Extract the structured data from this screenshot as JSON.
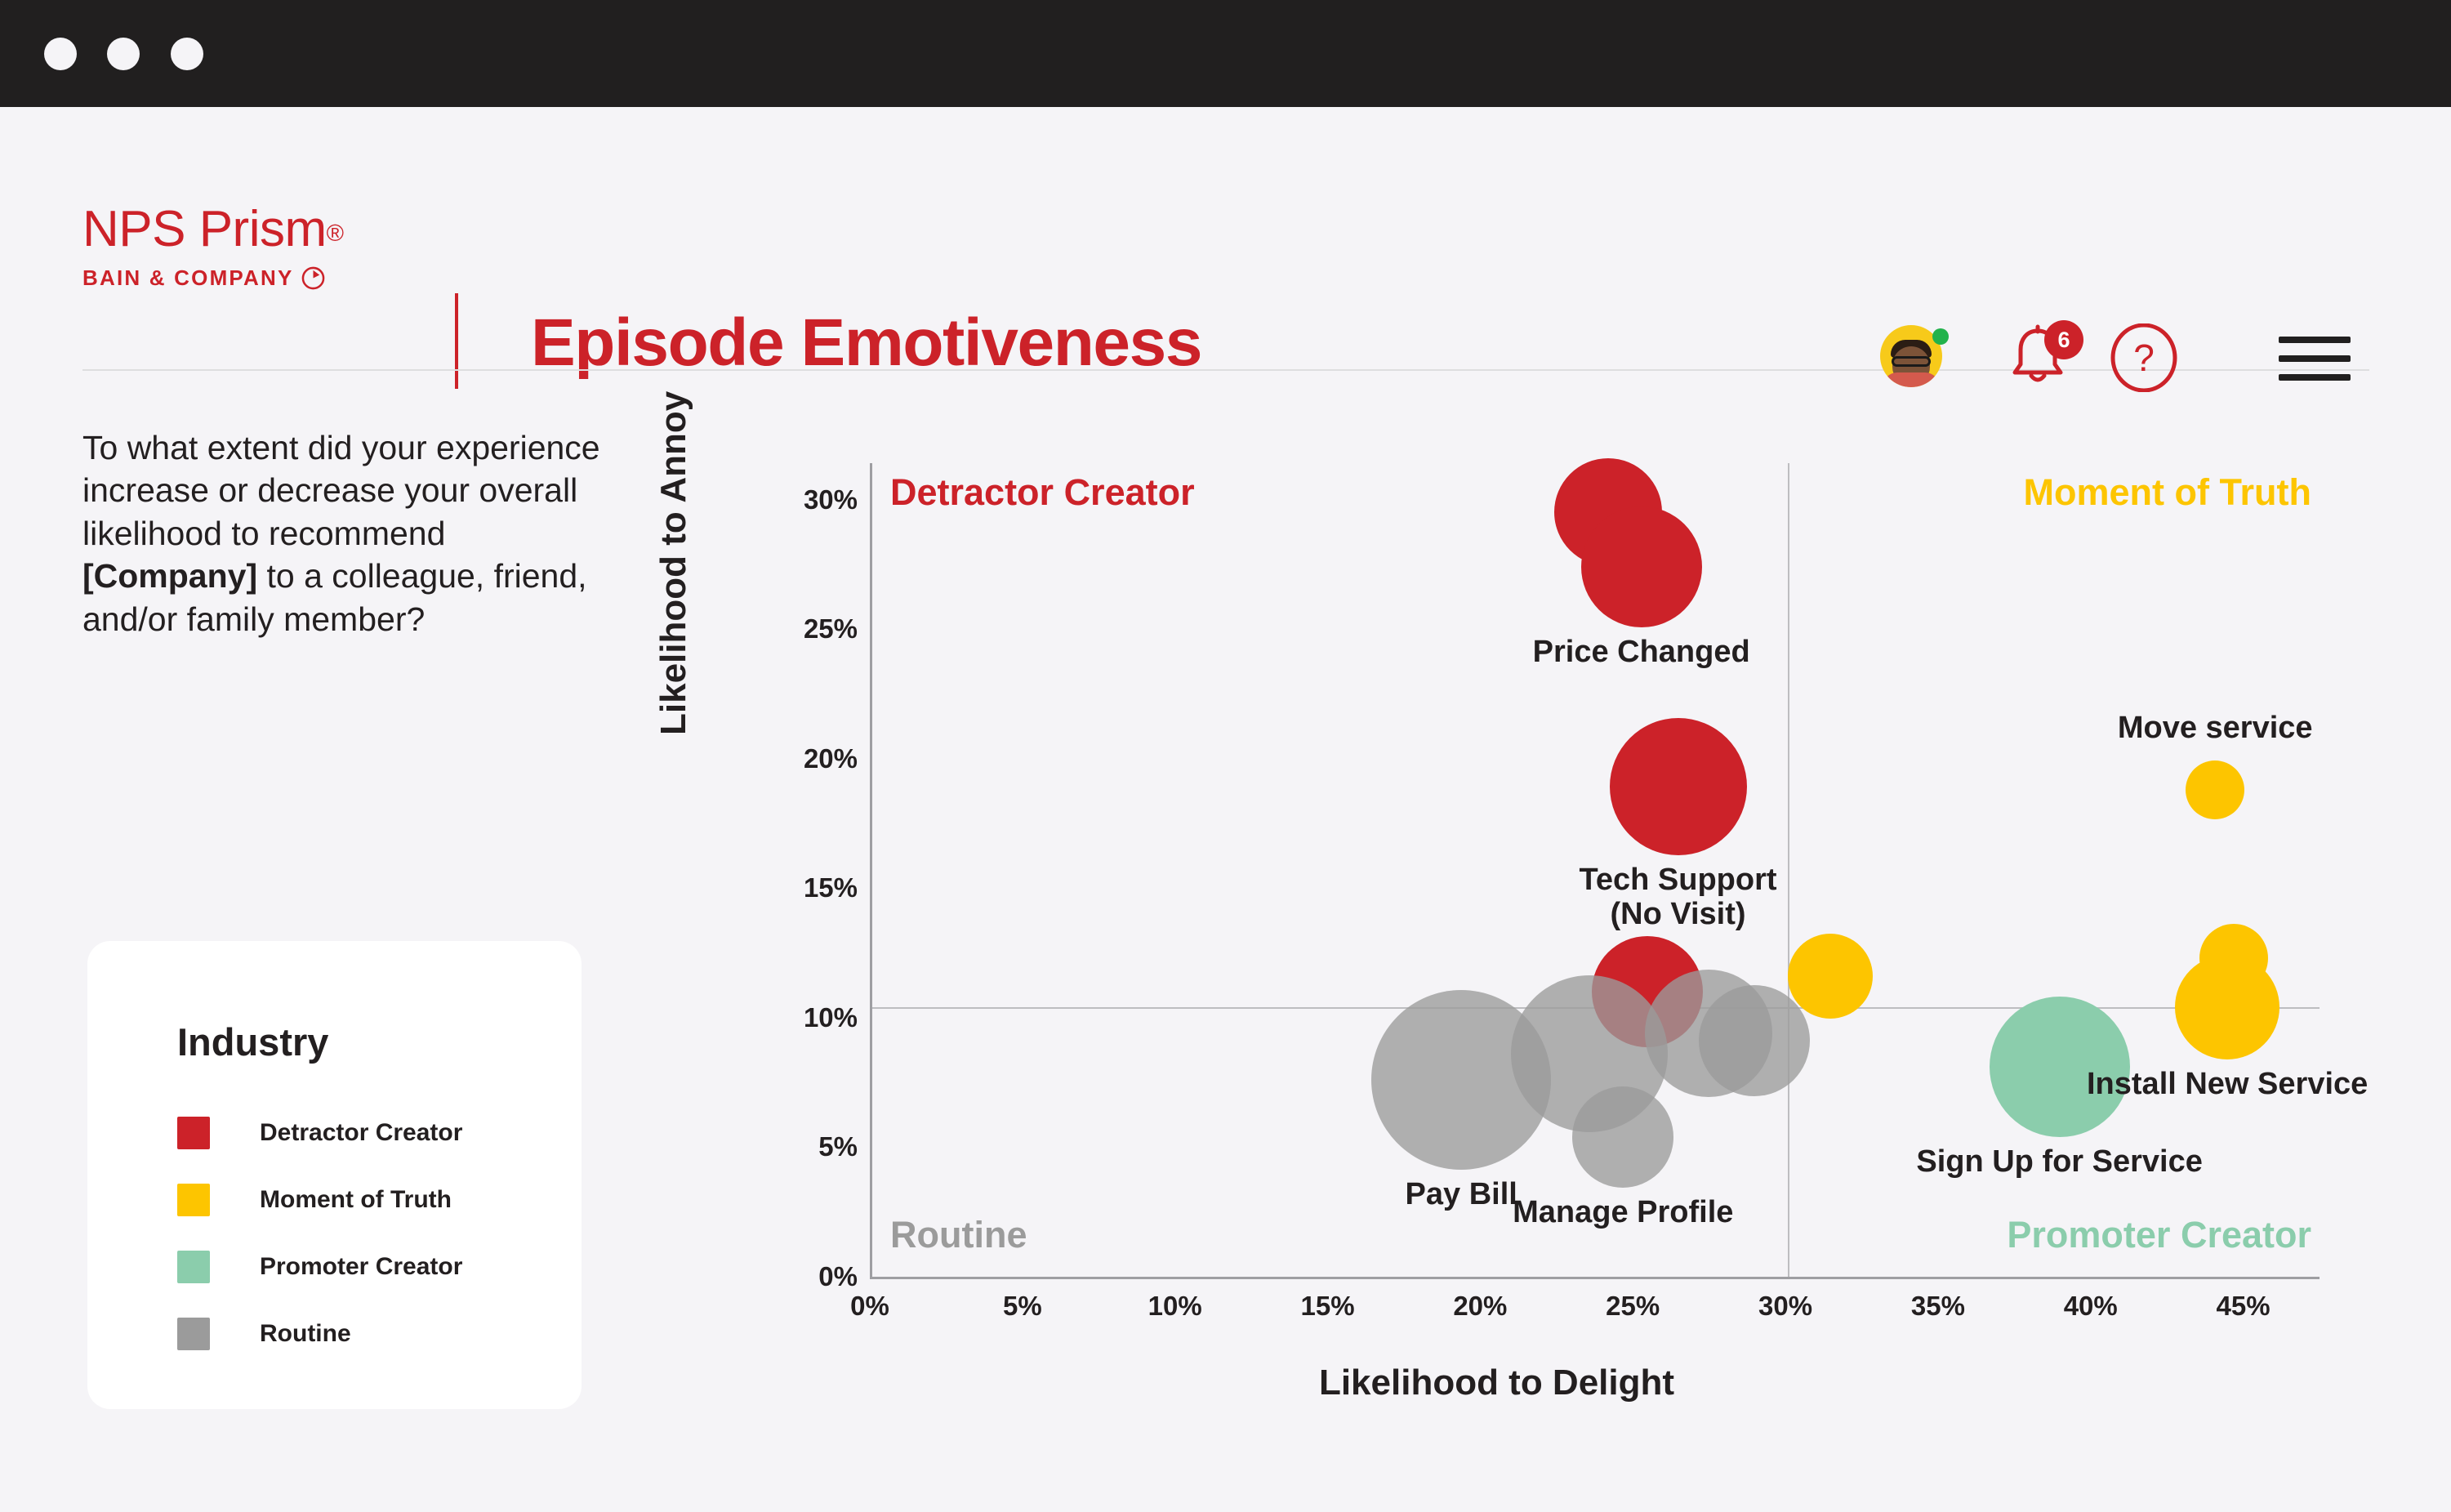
{
  "window": {
    "traffic_lights": [
      "close-dot",
      "minimize-dot",
      "maximize-dot"
    ]
  },
  "header": {
    "logo_main": "NPS Prism",
    "logo_registered": "®",
    "logo_sub": "BAIN & COMPANY",
    "page_title": "Episode Emotiveness",
    "notification_count": "6",
    "help_glyph": "?",
    "avatar_name": "user-avatar",
    "status": "online"
  },
  "sidebar": {
    "question_line1": "To what extent did your experience increase or decrease your overall likelihood to recommend ",
    "question_company": "[Company]",
    "question_line2": " to a colleague, friend, and/or family member?",
    "legend": {
      "title": "Industry",
      "items": [
        {
          "label": "Detractor Creator",
          "color": "#cc2229"
        },
        {
          "label": "Moment of Truth",
          "color": "#fdc500"
        },
        {
          "label": "Promoter Creator",
          "color": "#8bcdac"
        },
        {
          "label": "Routine",
          "color": "#9b9b9b"
        }
      ]
    }
  },
  "chart_data": {
    "type": "scatter",
    "title": "Episode Emotiveness",
    "xlabel": "Likelihood to Delight",
    "ylabel": "Likelihood to Annoy",
    "xlim": [
      0,
      47.5
    ],
    "ylim": [
      0,
      31.5
    ],
    "xticks": [
      "0%",
      "5%",
      "10%",
      "15%",
      "20%",
      "25%",
      "30%",
      "35%",
      "40%",
      "45%"
    ],
    "xtick_values": [
      0,
      5,
      10,
      15,
      20,
      25,
      30,
      35,
      40,
      45
    ],
    "yticks": [
      "0%",
      "5%",
      "10%",
      "15%",
      "20%",
      "25%",
      "30%"
    ],
    "ytick_values": [
      0,
      5,
      10,
      15,
      20,
      25,
      30
    ],
    "grid": false,
    "quadrant_lines": {
      "x": 30,
      "y": 10.5
    },
    "quadrants": [
      {
        "label": "Detractor Creator",
        "color": "#cc2229",
        "position": "top-left"
      },
      {
        "label": "Moment of Truth",
        "color": "#fdc500",
        "position": "top-right"
      },
      {
        "label": "Routine",
        "color": "#9b9b9b",
        "position": "bottom-left"
      },
      {
        "label": "Promoter Creator",
        "color": "#8bcdac",
        "position": "bottom-right"
      }
    ],
    "legend_position": "left-card",
    "size_encoding": "episode volume",
    "points": [
      {
        "label": "",
        "series": "Detractor Creator",
        "x": 24.1,
        "y": 29.6,
        "size": 66,
        "color": "#cc2229"
      },
      {
        "label": "Price Changed",
        "series": "Detractor Creator",
        "x": 25.2,
        "y": 27.5,
        "size": 74,
        "color": "#cc2229",
        "label_pos": "below"
      },
      {
        "label": "Tech Support\n(No Visit)",
        "series": "Detractor Creator",
        "x": 26.4,
        "y": 19.0,
        "size": 84,
        "color": "#cc2229",
        "label_pos": "below"
      },
      {
        "label": "",
        "series": "Detractor Creator",
        "x": 25.4,
        "y": 11.1,
        "size": 68,
        "color": "#cc2229"
      },
      {
        "label": "",
        "series": "Moment of Truth",
        "x": 31.4,
        "y": 11.7,
        "size": 52,
        "color": "#fdc500"
      },
      {
        "label": "Move service",
        "series": "Moment of Truth",
        "x": 44.0,
        "y": 18.9,
        "size": 36,
        "color": "#fdc500",
        "label_pos": "above"
      },
      {
        "label": "",
        "series": "Moment of Truth",
        "x": 44.6,
        "y": 12.4,
        "size": 42,
        "color": "#fdc500"
      },
      {
        "label": "Install New Service",
        "series": "Moment of Truth",
        "x": 44.4,
        "y": 10.5,
        "size": 64,
        "color": "#fdc500",
        "label_pos": "below"
      },
      {
        "label": "Sign Up for Service",
        "series": "Promoter Creator",
        "x": 38.9,
        "y": 8.2,
        "size": 86,
        "color": "#8bcdac",
        "label_pos": "below"
      },
      {
        "label": "Pay Bill",
        "series": "Routine",
        "x": 19.3,
        "y": 7.7,
        "size": 110,
        "color": "#9b9b9b",
        "label_pos": "below"
      },
      {
        "label": "",
        "series": "Routine",
        "x": 23.5,
        "y": 8.7,
        "size": 96,
        "color": "#9b9b9b"
      },
      {
        "label": "Manage Profile",
        "series": "Routine",
        "x": 24.6,
        "y": 5.5,
        "size": 62,
        "color": "#9b9b9b",
        "label_pos": "below"
      },
      {
        "label": "",
        "series": "Routine",
        "x": 27.4,
        "y": 9.5,
        "size": 78,
        "color": "#9b9b9b"
      },
      {
        "label": "",
        "series": "Routine",
        "x": 28.9,
        "y": 9.2,
        "size": 68,
        "color": "#9b9b9b"
      }
    ]
  }
}
